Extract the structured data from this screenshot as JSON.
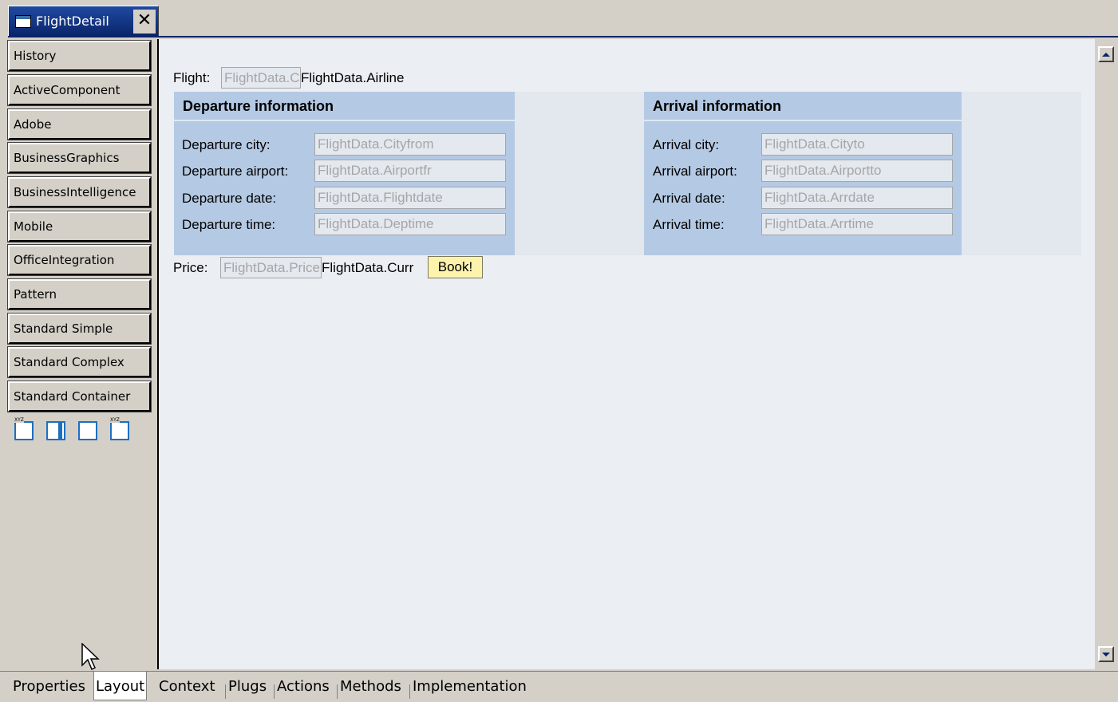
{
  "editor_tab": {
    "title": "FlightDetail",
    "close": "✕"
  },
  "palette": {
    "items": [
      "History",
      "ActiveComponent",
      "Adobe",
      "BusinessGraphics",
      "BusinessIntelligence",
      "Mobile",
      "OfficeIntegration",
      "Pattern",
      "Standard Simple",
      "Standard Complex",
      "Standard Container"
    ],
    "icon_xyz": "XYZ"
  },
  "form": {
    "flight_label": "Flight:",
    "flight_field": "FlightData.Carrid",
    "airline_text": "FlightData.Airline",
    "departure": {
      "title": "Departure information",
      "rows": [
        {
          "label": "Departure city:",
          "value": "FlightData.Cityfrom"
        },
        {
          "label": "Departure airport:",
          "value": "FlightData.Airportfr"
        },
        {
          "label": "Departure date:",
          "value": "FlightData.Flightdate"
        },
        {
          "label": "Departure time:",
          "value": "FlightData.Deptime"
        }
      ]
    },
    "arrival": {
      "title": "Arrival information",
      "rows": [
        {
          "label": "Arrival city:",
          "value": "FlightData.Cityto"
        },
        {
          "label": "Arrival airport:",
          "value": "FlightData.Airportto"
        },
        {
          "label": "Arrival date:",
          "value": "FlightData.Arrdate"
        },
        {
          "label": "Arrival time:",
          "value": "FlightData.Arrtime"
        }
      ]
    },
    "price_label": "Price:",
    "price_field": "FlightData.Price",
    "currency_text": "FlightData.Curr",
    "book_button": "Book!"
  },
  "bottom_tabs": [
    "Properties",
    "Layout",
    "Context",
    "Plugs",
    "Actions",
    "Methods",
    "Implementation"
  ],
  "active_bottom_tab": "Layout",
  "colors": {
    "group_background": "#b4c9e3",
    "canvas_background": "#ebeef3",
    "button_background": "#fdf3ad",
    "tab_active": "#0a246a"
  }
}
